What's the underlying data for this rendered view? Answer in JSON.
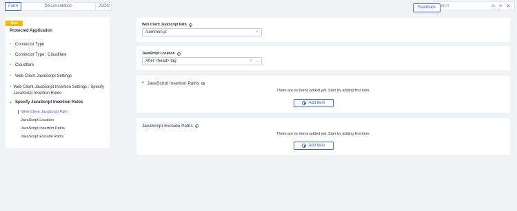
{
  "tabs": {
    "form": "Form",
    "documentation": "Documentation",
    "json": "JSON"
  },
  "feedback_label": "Feedback",
  "search": {
    "placeholder": "Search"
  },
  "sidebar": {
    "badge": "New",
    "title": "Protected Application",
    "items": [
      {
        "label": "Connector Type"
      },
      {
        "label": "Connector Type : Cloudflare"
      },
      {
        "label": "Cloudflare"
      },
      {
        "label": "Web Client JavaScript Settings"
      },
      {
        "label": "Web Client JavaScript Insertion Settings : Specify JavaScript Insertion Rules"
      },
      {
        "label": "Specify JavaScript Insertion Rules"
      }
    ],
    "subitems": [
      {
        "label": "Web Client JavaScript Path"
      },
      {
        "label": "JavaScript Location"
      },
      {
        "label": "JavaScript Insertion Paths"
      },
      {
        "label": "JavaScript Exclude Paths"
      }
    ]
  },
  "main": {
    "js_path": {
      "label": "Web Client JavaScript Path",
      "value": "/common.js"
    },
    "js_location": {
      "label": "JavaScript Location",
      "value": "After <head> tag"
    },
    "insertion_paths": {
      "required_mark": "*",
      "title": "JavaScript Insertion Paths",
      "empty": "There are no items added yet. Start by adding first item.",
      "add_label": "Add Item"
    },
    "exclude_paths": {
      "title": "JavaScript Exclude Paths",
      "empty": "There are no items added yet. Start by adding first item.",
      "add_label": "Add Item"
    }
  },
  "colors": {
    "accent": "#3d5fd8",
    "badge": "#f5b800",
    "background": "#f1f2f5"
  }
}
